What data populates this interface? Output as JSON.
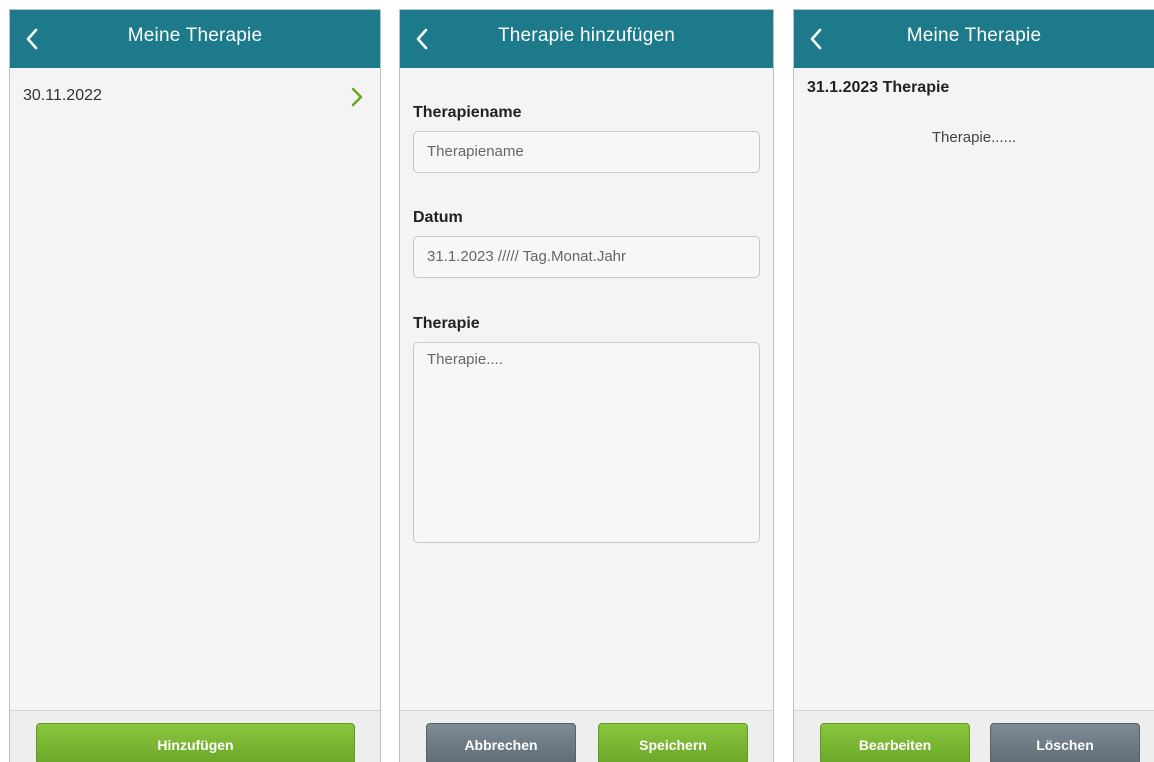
{
  "screens": [
    {
      "header": {
        "title": "Meine Therapie",
        "back_icon": "chevron-left-icon"
      },
      "list": [
        {
          "date": "30.11.2022",
          "chevron_icon": "chevron-right-icon"
        }
      ],
      "footer": {
        "add_label": "Hinzufügen"
      }
    },
    {
      "header": {
        "title": "Therapie hinzufügen",
        "back_icon": "chevron-left-icon"
      },
      "form": {
        "name_label": "Therapiename",
        "name_placeholder": "Therapiename",
        "date_label": "Datum",
        "date_placeholder": "31.1.2023 ///// Tag.Monat.Jahr",
        "therapy_label": "Therapie",
        "therapy_placeholder": "Therapie...."
      },
      "footer": {
        "cancel_label": "Abbrechen",
        "save_label": "Speichern"
      }
    },
    {
      "header": {
        "title": "Meine Therapie",
        "back_icon": "chevron-left-icon"
      },
      "detail": {
        "title": "31.1.2023 Therapie",
        "body": "Therapie......"
      },
      "footer": {
        "edit_label": "Bearbeiten",
        "delete_label": "Löschen"
      }
    }
  ],
  "colors": {
    "header": "#1c7a8a",
    "primary_button": "#7ab833",
    "secondary_button": "#6c7983",
    "chevron": "#6aa628"
  }
}
